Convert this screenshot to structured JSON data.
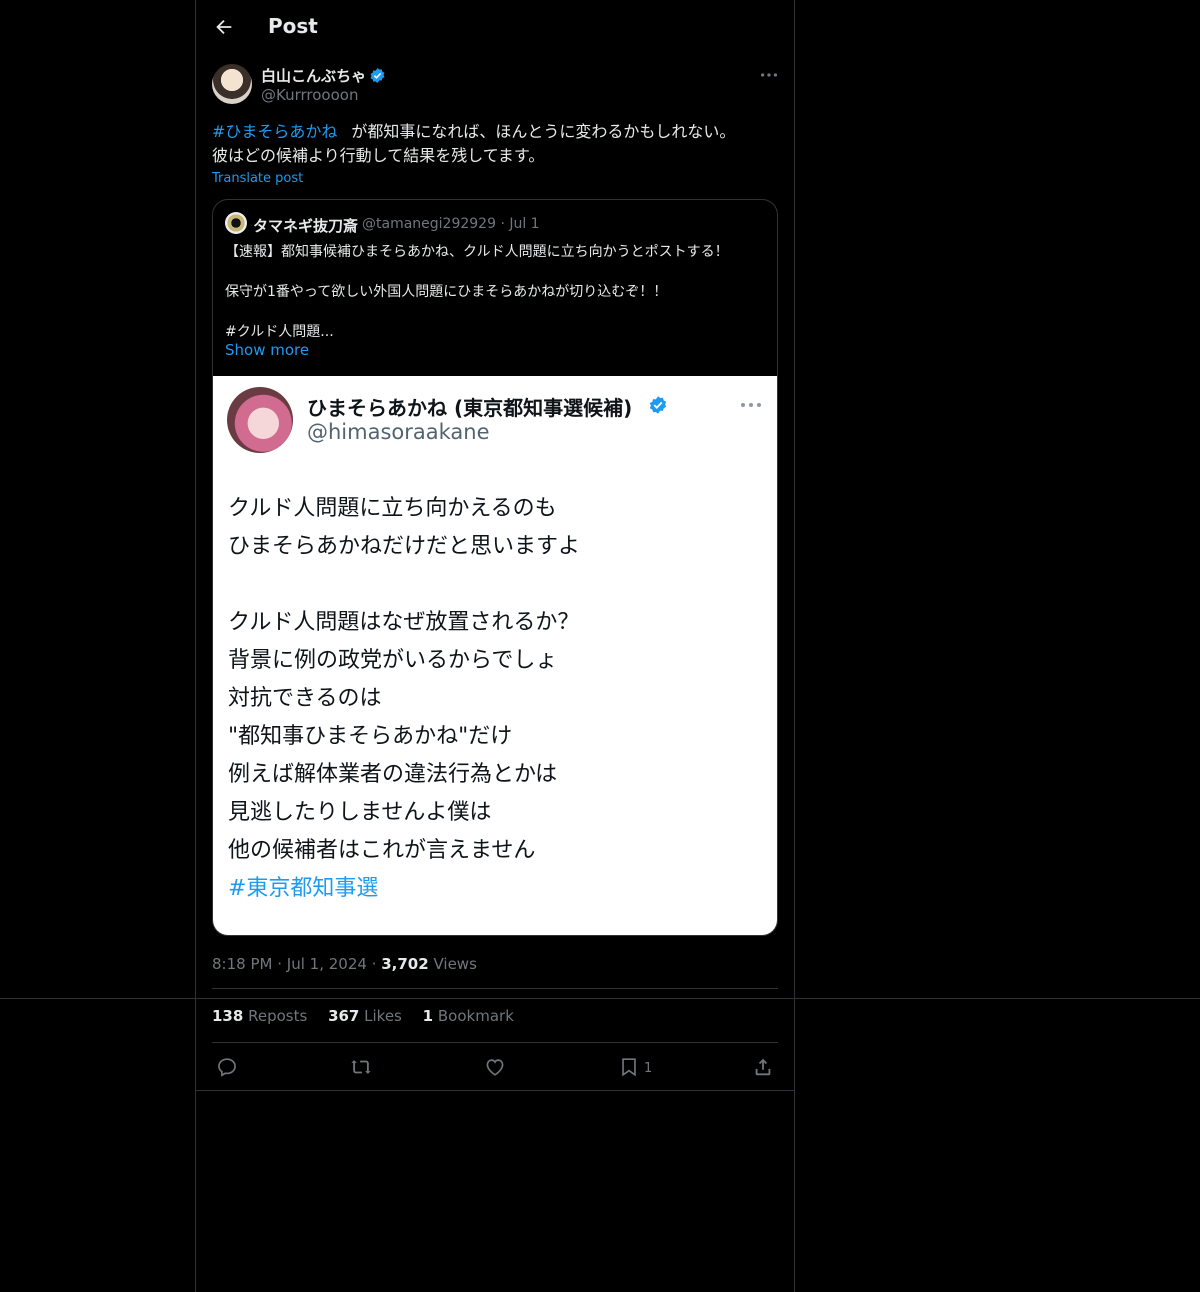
{
  "header": {
    "title": "Post",
    "back_icon": "arrow-left-icon"
  },
  "author": {
    "name": "白山こんぶちゃ",
    "handle": "@Kurrroooon",
    "verified_color": "#1d9bf0"
  },
  "post": {
    "hashtag": "#ひまそらあかね",
    "line1_rest": "が都知事になれば、ほんとうに変わるかもしれない。",
    "line2": "彼はどの候補より行動して結果を残してます。",
    "translate_label": "Translate post"
  },
  "quote": {
    "name": "タマネギ抜刀斎",
    "handle_date": "@tamanegi292929 · Jul 1",
    "line1": "【速報】都知事候補ひまそらあかね、クルド人問題に立ち向かうとポストする！",
    "line2": "保守が1番やって欲しい外国人問題にひまそらあかねが切り込むぞ！！",
    "line3": "#クルド人問題...",
    "show_more": "Show more",
    "screenshot": {
      "name": "ひまそらあかね (東京都知事選候補)",
      "handle": "@himasoraakane",
      "lines": [
        "クルド人問題に立ち向かえるのも",
        "ひまそらあかねだけだと思いますよ",
        "",
        "クルド人問題はなぜ放置されるか？",
        "背景に例の政党がいるからでしょ",
        "対抗できるのは",
        "\"都知事ひまそらあかね\"だけ",
        "例えば解体業者の違法行為とかは",
        "見逃したりしませんよ僕は",
        "他の候補者はこれが言えません"
      ],
      "hashtag": "#東京都知事選"
    }
  },
  "meta": {
    "time": "8:18 PM",
    "date": "Jul 1, 2024",
    "views_count": "3,702",
    "views_label": "Views"
  },
  "stats": {
    "reposts_count": "138",
    "reposts_label": "Reposts",
    "likes_count": "367",
    "likes_label": "Likes",
    "bookmarks_count": "1",
    "bookmarks_label": "Bookmark"
  },
  "actions": {
    "bookmark_count": "1"
  }
}
